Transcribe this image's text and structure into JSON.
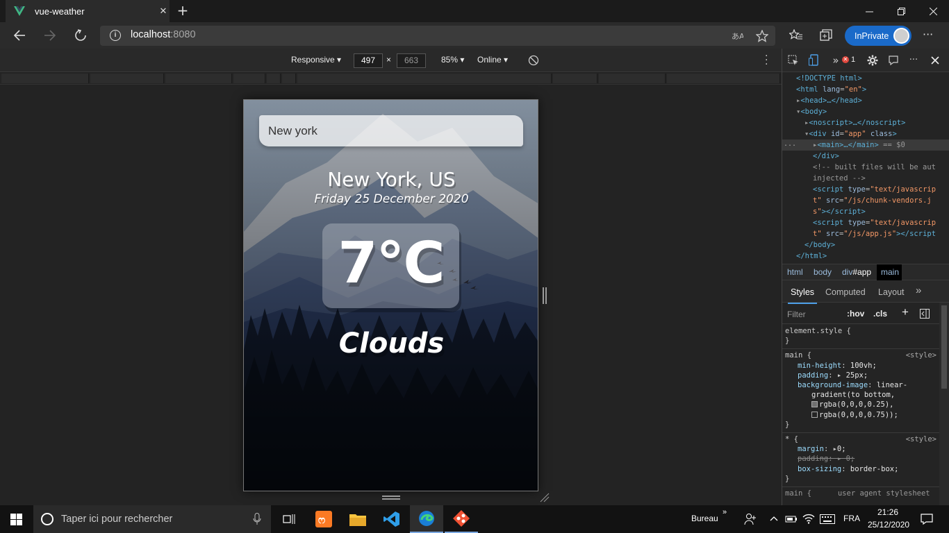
{
  "browser": {
    "tab_title": "vue-weather",
    "tab_close": "✕",
    "new_tab": "+",
    "address": {
      "host": "localhost",
      "port": ":8080"
    },
    "inprivate_label": "InPrivate",
    "more": "···"
  },
  "device_toolbar": {
    "mode": "Responsive",
    "width": "497",
    "times": "×",
    "height": "663",
    "zoom": "85%",
    "network": "Online"
  },
  "app": {
    "search_value": "New york",
    "city": "New York, US",
    "date": "Friday 25 December 2020",
    "temperature": "7°C",
    "weather": "Clouds"
  },
  "devtools": {
    "error_count": "1",
    "error_icon": "✕",
    "dom_lines": [
      {
        "indent": 1,
        "html": "<span class='tag'>&lt;!DOCTYPE html&gt;</span>"
      },
      {
        "indent": 1,
        "html": "<span class='tag'>&lt;html</span> <span class='atn'>lang</span>=<span class='atv'>\"en\"</span><span class='tag'>&gt;</span>"
      },
      {
        "indent": 1,
        "html": "<span class='cm'>▸</span><span class='tag'>&lt;head&gt;…&lt;/head&gt;</span>"
      },
      {
        "indent": 1,
        "html": "<span class='cm'>▾</span><span class='tag'>&lt;body&gt;</span>"
      },
      {
        "indent": 2,
        "html": "<span class='cm'>▸</span><span class='tag'>&lt;noscript&gt;…&lt;/noscript&gt;</span>"
      },
      {
        "indent": 2,
        "html": "<span class='cm'>▾</span><span class='tag'>&lt;div</span> <span class='atn'>id</span>=<span class='atv'>\"app\"</span> <span class='atn'>class</span><span class='tag'>&gt;</span>"
      },
      {
        "indent": 3,
        "html": "<span class='cm'>▸</span><span class='tag'>&lt;main&gt;…&lt;/main&gt;</span> <span class='cm'>== $0</span>",
        "selected": true
      },
      {
        "indent": 3,
        "html": "<span class='tag'>&lt;/div&gt;</span>"
      },
      {
        "indent": 3,
        "html": "<span class='cm'>&lt;!-- built files will be aut</span>"
      },
      {
        "indent": 3,
        "html": "<span class='cm'>injected --&gt;</span>"
      },
      {
        "indent": 3,
        "html": "<span class='tag'>&lt;script</span> <span class='atn'>type</span>=<span class='atv'>\"text/javascrip</span>"
      },
      {
        "indent": 3,
        "html": "<span class='atv'>t\"</span> <span class='atn'>src</span>=<span class='atv'>\"/js/chunk-vendors.j</span>"
      },
      {
        "indent": 3,
        "html": "<span class='atv'>s\"</span><span class='tag'>&gt;&lt;/script&gt;</span>"
      },
      {
        "indent": 3,
        "html": "<span class='tag'>&lt;script</span> <span class='atn'>type</span>=<span class='atv'>\"text/javascrip</span>"
      },
      {
        "indent": 3,
        "html": "<span class='atv'>t\"</span> <span class='atn'>src</span>=<span class='atv'>\"/js/app.js\"</span><span class='tag'>&gt;&lt;/script</span>"
      },
      {
        "indent": 2,
        "html": "<span class='tag'>&lt;/body&gt;</span>"
      },
      {
        "indent": 1,
        "html": "<span class='tag'>&lt;/html&gt;</span>"
      }
    ],
    "dom_dots": "...",
    "breadcrumbs": [
      "html",
      "body",
      "div",
      "#app"
    ],
    "breadcrumb_active": "main",
    "style_tabs": [
      "Styles",
      "Computed",
      "Layout"
    ],
    "filter_placeholder": "Filter",
    "hov": ":hov",
    "cls": ".cls",
    "rules": {
      "element_style": "element.style {",
      "close": "}",
      "main_selector": "main {",
      "style_source": "<style>",
      "min_height_prop": "min-height",
      "min_height_val": "100vh;",
      "padding_prop": "padding",
      "padding_val": "25px;",
      "bg_prop": "background-image",
      "bg_val1": "linear-",
      "bg_val2": "gradient(to bottom,",
      "bg_val3": "rgba(0,0,0,0.25),",
      "bg_val4": "rgba(0,0,0,0.75));",
      "star_selector": "* {",
      "margin_prop": "margin",
      "margin_val": "0;",
      "padding2_prop": "padding",
      "padding2_val": "0;",
      "box_prop": "box-sizing",
      "box_val": "border-box;",
      "next": "main {      user agent stylesheet"
    }
  },
  "taskbar": {
    "search_placeholder": "Taper ici pour rechercher",
    "bureau": "Bureau",
    "chevrons": "»",
    "lang": "FRA",
    "time": "21:26",
    "date": "25/12/2020"
  },
  "colors": {
    "accent": "#1a6ac9",
    "vue_green": "#41b883",
    "vue_dark": "#35495e",
    "sky_top": "#9fb3c9",
    "mountain": "#7d93b7",
    "forest": "#0c1220"
  }
}
